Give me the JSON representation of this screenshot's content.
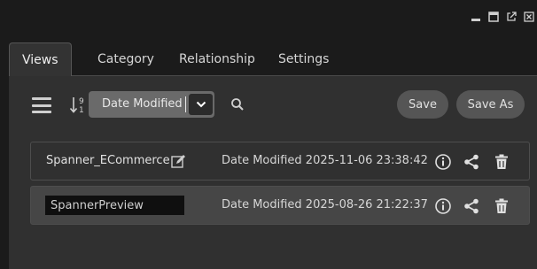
{
  "tabs": [
    {
      "label": "Views",
      "active": true
    },
    {
      "label": "Category",
      "active": false
    },
    {
      "label": "Relationship",
      "active": false
    },
    {
      "label": "Settings",
      "active": false
    }
  ],
  "toolbar": {
    "sort_field": "Date Modified",
    "save_label": "Save",
    "save_as_label": "Save As"
  },
  "views": [
    {
      "name": "Spanner_ECommerce",
      "date": "Date Modified 2025-11-06 23:38:42",
      "editing": false
    },
    {
      "name": "SpannerPreview",
      "date": "Date Modified 2025-08-26 21:22:37",
      "editing": true
    }
  ],
  "colors": {
    "background": "#1b1b1b",
    "panel": "#303030",
    "selected_row": "#464646",
    "pill_button": "#555555",
    "text": "#d6d6d6"
  }
}
